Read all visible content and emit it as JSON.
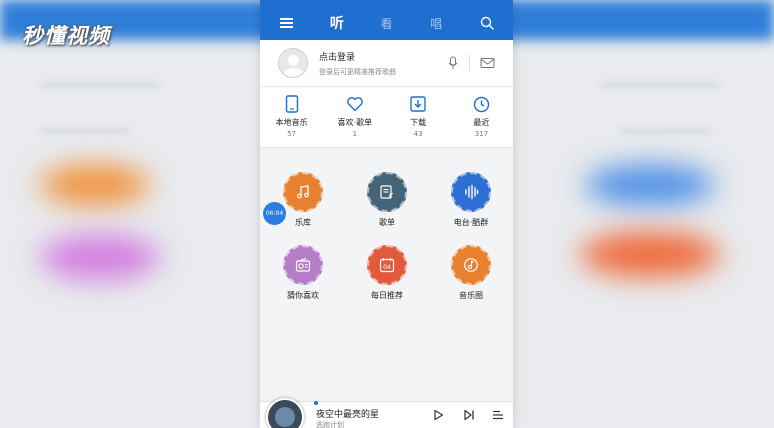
{
  "watermark": "秒懂视频",
  "colors": {
    "primary": "#1f6fd0",
    "orange": "#e7802f",
    "slate": "#456478",
    "blue": "#2d6fd2",
    "purple": "#b57cc8",
    "red": "#e25a3e",
    "orange2": "#e7802f"
  },
  "topbar": {
    "menu_icon": "menu-icon",
    "tabs": [
      {
        "label": "听",
        "active": true
      },
      {
        "label": "看",
        "active": false
      },
      {
        "label": "唱",
        "active": false
      }
    ],
    "search_icon": "search-icon"
  },
  "login": {
    "title": "点击登录",
    "subtitle": "登录后可更精准推荐歌曲"
  },
  "quick": [
    {
      "label": "本地音乐",
      "count": "57",
      "icon": "phone-icon"
    },
    {
      "label": "喜欢·歌单",
      "count": "1",
      "icon": "heart-icon"
    },
    {
      "label": "下载",
      "count": "43",
      "icon": "download-icon"
    },
    {
      "label": "最近",
      "count": "317",
      "icon": "clock-icon"
    }
  ],
  "grid": [
    {
      "label": "乐库",
      "icon": "music-note-icon"
    },
    {
      "label": "歌单",
      "icon": "playlist-icon"
    },
    {
      "label": "电台·酷群",
      "icon": "soundwave-icon"
    },
    {
      "label": "猜你喜欢",
      "icon": "radio-icon"
    },
    {
      "label": "每日推荐",
      "icon": "calendar-icon",
      "day": "04"
    },
    {
      "label": "音乐圈",
      "icon": "music-circle-icon"
    }
  ],
  "time_badge": "06:04",
  "player": {
    "song": "夜空中最亮的星",
    "artist": "逃跑计划"
  }
}
